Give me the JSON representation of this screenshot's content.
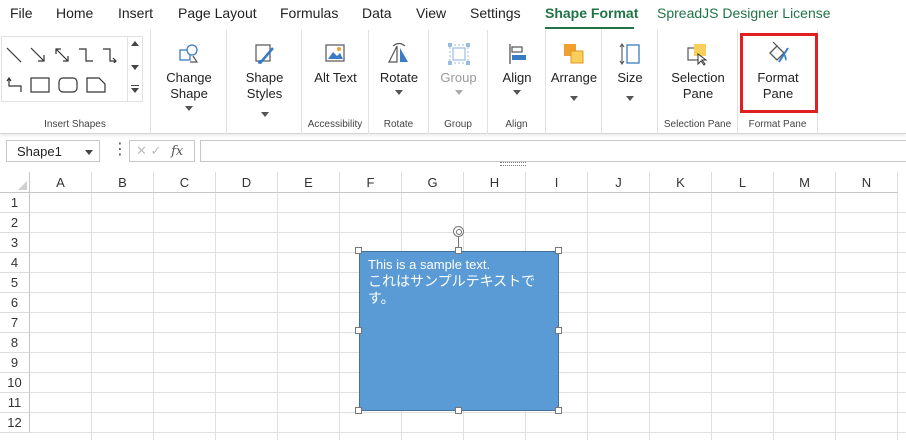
{
  "menu": {
    "items": [
      "File",
      "Home",
      "Insert",
      "Page Layout",
      "Formulas",
      "Data",
      "View",
      "Settings",
      "Shape Format",
      "SpreadJS Designer License"
    ],
    "active": "Shape Format"
  },
  "ribbon": {
    "insert_shapes": {
      "label": "Insert Shapes"
    },
    "change_shape": {
      "line1": "Change",
      "line2": "Shape"
    },
    "shape_styles": {
      "line1": "Shape",
      "line2": "Styles"
    },
    "accessibility": {
      "button": "Alt Text",
      "label": "Accessibility"
    },
    "rotate": {
      "button": "Rotate",
      "label": "Rotate"
    },
    "group": {
      "button": "Group",
      "label": "Group"
    },
    "align": {
      "button": "Align",
      "label": "Align"
    },
    "arrange": {
      "button": "Arrange"
    },
    "size": {
      "button": "Size"
    },
    "selection_pane": {
      "line1": "Selection",
      "line2": "Pane",
      "label": "Selection Pane"
    },
    "format_pane": {
      "line1": "Format",
      "line2": "Pane",
      "label": "Format Pane"
    }
  },
  "formula_bar": {
    "name_box": "Shape1",
    "fx": "fx",
    "formula": ""
  },
  "grid": {
    "columns": [
      "A",
      "B",
      "C",
      "D",
      "E",
      "F",
      "G",
      "H",
      "I",
      "J",
      "K",
      "L",
      "M",
      "N"
    ],
    "rows": [
      "1",
      "2",
      "3",
      "4",
      "5",
      "6",
      "7",
      "8",
      "9",
      "10",
      "11",
      "12"
    ]
  },
  "shape": {
    "line1": "This is a sample text.",
    "line2": "これはサンプルテキストです。",
    "fill": "#5b9bd5"
  },
  "colors": {
    "accent": "#217346",
    "highlight": "#e02020"
  }
}
